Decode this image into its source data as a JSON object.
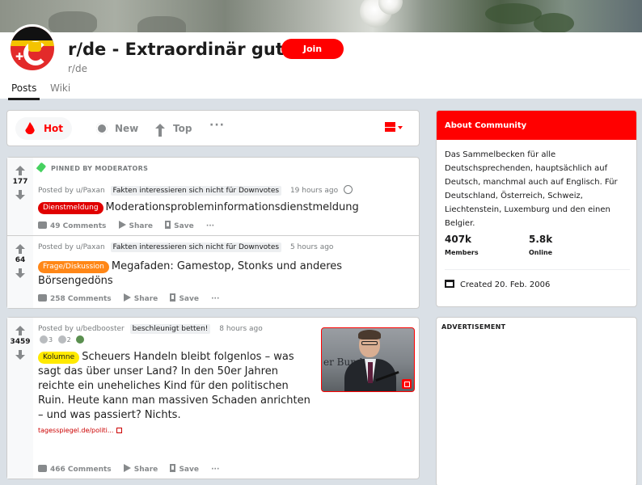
{
  "subreddit": {
    "title": "r/de - Extraordinär gut!",
    "name": "r/de",
    "join_label": "Join",
    "tabs": [
      {
        "label": "Posts",
        "active": true
      },
      {
        "label": "Wiki",
        "active": false
      }
    ]
  },
  "sort": {
    "hot": "Hot",
    "new": "New",
    "top": "Top",
    "more": "···"
  },
  "posts": [
    {
      "pinned_label": "PINNED BY MODERATORS",
      "score": "177",
      "posted_by": "Posted by u/Paxan",
      "user_flair": "Fakten interessieren sich nicht für Downvotes",
      "time": "19 hours ago",
      "flair": "Dienstmeldung",
      "title": "Moderationsprobleminformationsdienstmeldung",
      "comments": "49 Comments",
      "share": "Share",
      "save": "Save",
      "more": "···"
    },
    {
      "score": "64",
      "posted_by": "Posted by u/Paxan",
      "user_flair": "Fakten interessieren sich nicht für Downvotes",
      "time": "5 hours ago",
      "flair": "Frage/Diskussion",
      "title": "Megafaden: Gamestop, Stonks und anderes Börsengedöns",
      "comments": "258 Comments",
      "share": "Share",
      "save": "Save",
      "more": "···"
    },
    {
      "score": "3459",
      "posted_by": "Posted by u/bedbooster",
      "user_flair": "beschleunigt betten!",
      "time": "8 hours ago",
      "award_count_1": "3",
      "award_count_2": "2",
      "flair": "Kolumne",
      "title": "Scheuers Handeln bleibt folgenlos – was sagt das über unser Land? In den 50er Jahren reichte ein uneheliches Kind für den politischen Ruin. Heute kann man massiven Schaden anrichten – und was passiert? Nichts.",
      "domain": "tagesspiegel.de/politi...",
      "thumbnail_text": "er Bund",
      "comments": "466 Comments",
      "share": "Share",
      "save": "Save",
      "more": "···"
    }
  ],
  "about": {
    "heading": "About Community",
    "description": "Das Sammelbecken für alle Deutschsprechenden, hauptsächlich auf Deutsch, manchmal auch auf Englisch. Für Deutschland, Österreich, Schweiz, Liechtenstein, Luxemburg und den einen Belgier.",
    "members_value": "407k",
    "members_label": "Members",
    "online_value": "5.8k",
    "online_label": "Online",
    "created": "Created 20. Feb. 2006"
  },
  "ad": {
    "label": "ADVERTISEMENT"
  },
  "colors": {
    "accent": "#ff0000",
    "flair_red": "#e00000",
    "flair_orange": "#ff8717",
    "flair_yellow": "#ffea00",
    "background": "#dae0e6"
  },
  "icons": [
    "flame-icon",
    "gear-icon",
    "top-icon",
    "pin-icon",
    "comment-icon",
    "share-icon",
    "bookmark-icon",
    "cake-icon",
    "external-link-icon",
    "view-card-icon"
  ]
}
